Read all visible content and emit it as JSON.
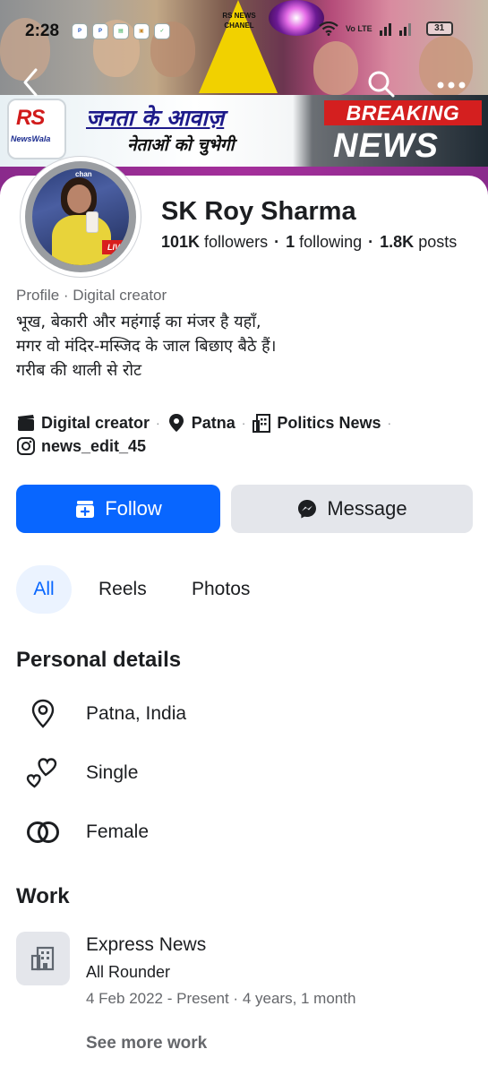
{
  "status_bar": {
    "time": "2:28",
    "network": "Vo LTE",
    "battery": "31"
  },
  "cover": {
    "badge_text": "RS NEWS CHANEL",
    "logo_text": "RS",
    "logo_sub": "NewsWala",
    "headline": "जनता के आवाज़",
    "tagline": "नेताओं को चुभेगी",
    "breaking": "BREAKING",
    "news": "NEWS"
  },
  "profile": {
    "name": "SK Roy Sharma",
    "followers_count": "101K",
    "followers_label": "followers",
    "following_count": "1",
    "following_label": "following",
    "posts_count": "1.8K",
    "posts_label": "posts",
    "kind": "Profile · Digital creator",
    "bio": [
      "भूख, बेकारी और महंगाई का मंजर है यहाँ,",
      "मगर वो मंदिर-मस्जिद के जाल बिछाए बैठे हैं।",
      "गरीब की थाली से रोट"
    ],
    "meta": {
      "category": "Digital creator",
      "location": "Patna",
      "page": "Politics News",
      "instagram": "news_edit_45"
    }
  },
  "actions": {
    "follow_label": "Follow",
    "message_label": "Message",
    "follow_color": "#0866ff"
  },
  "tabs": [
    {
      "label": "All",
      "active": true
    },
    {
      "label": "Reels",
      "active": false
    },
    {
      "label": "Photos",
      "active": false
    }
  ],
  "personal_details": {
    "title": "Personal details",
    "items": [
      {
        "icon": "location-pin-icon",
        "text": "Patna, India"
      },
      {
        "icon": "hearts-icon",
        "text": "Single"
      },
      {
        "icon": "rings-icon",
        "text": "Female"
      }
    ]
  },
  "work": {
    "title": "Work",
    "company": "Express News",
    "role": "All Rounder",
    "dates": "4 Feb 2022 - Present · 4 years, 1 month",
    "see_more": "See more work"
  }
}
